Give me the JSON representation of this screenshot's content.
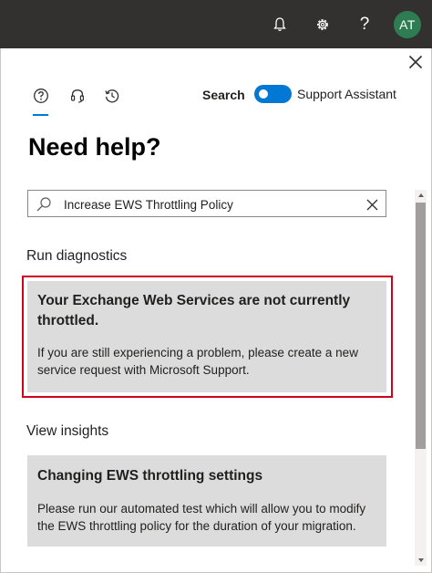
{
  "topbar": {
    "bell_icon": "bell-icon",
    "settings_icon": "gear-icon",
    "help_label": "?",
    "avatar_initials": "AT",
    "avatar_color": "#2e7d52"
  },
  "panel": {
    "close_icon": "close-icon",
    "tabs": [
      {
        "icon": "help-circle-icon",
        "selected": true
      },
      {
        "icon": "headset-icon",
        "selected": false
      },
      {
        "icon": "history-icon",
        "selected": false
      }
    ],
    "search_label": "Search",
    "toggle_label": "Support Assistant",
    "toggle_on": true,
    "title": "Need help?",
    "search": {
      "value": "Increase EWS Throttling Policy",
      "icon": "search-icon",
      "clear_icon": "clear-icon"
    },
    "diagnostics": {
      "heading": "Run diagnostics",
      "card_title": "Your Exchange Web Services are not currently throttled.",
      "card_body": "If you are still experiencing a problem, please create a new service request with Microsoft Support."
    },
    "insights": {
      "heading": "View insights",
      "card_title": "Changing EWS throttling settings",
      "card_body": "Please run our automated test which will allow you to modify the EWS throttling policy for the duration of your migration."
    }
  },
  "colors": {
    "accent": "#0078d4",
    "highlight_border": "#d0021b",
    "topbar_bg": "#323130",
    "card_bg": "#dcdcdc"
  }
}
